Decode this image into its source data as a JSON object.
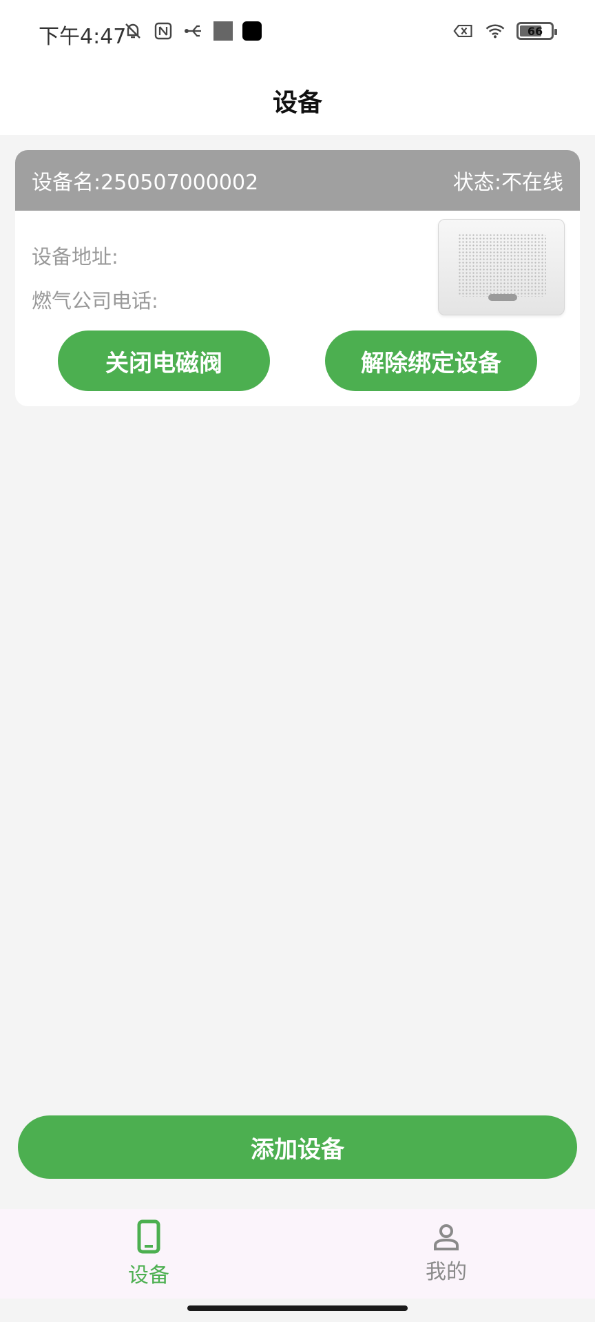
{
  "status_bar": {
    "time": "下午4:47",
    "battery_level": "66"
  },
  "header": {
    "title": "设备"
  },
  "device_card": {
    "name_label": "设备名:250507000002",
    "status_label": "状态:不在线",
    "address_label": "设备地址:",
    "gas_phone_label": "燃气公司电话:",
    "close_valve_button": "关闭电磁阀",
    "unbind_button": "解除绑定设备"
  },
  "add_device_button": "添加设备",
  "bottom_nav": {
    "items": [
      {
        "label": "设备",
        "icon": "phone-device-icon",
        "active": true
      },
      {
        "label": "我的",
        "icon": "person-icon",
        "active": false
      }
    ]
  },
  "colors": {
    "accent": "#4caf50",
    "card_header": "#a0a0a0",
    "background": "#f4f4f4"
  }
}
